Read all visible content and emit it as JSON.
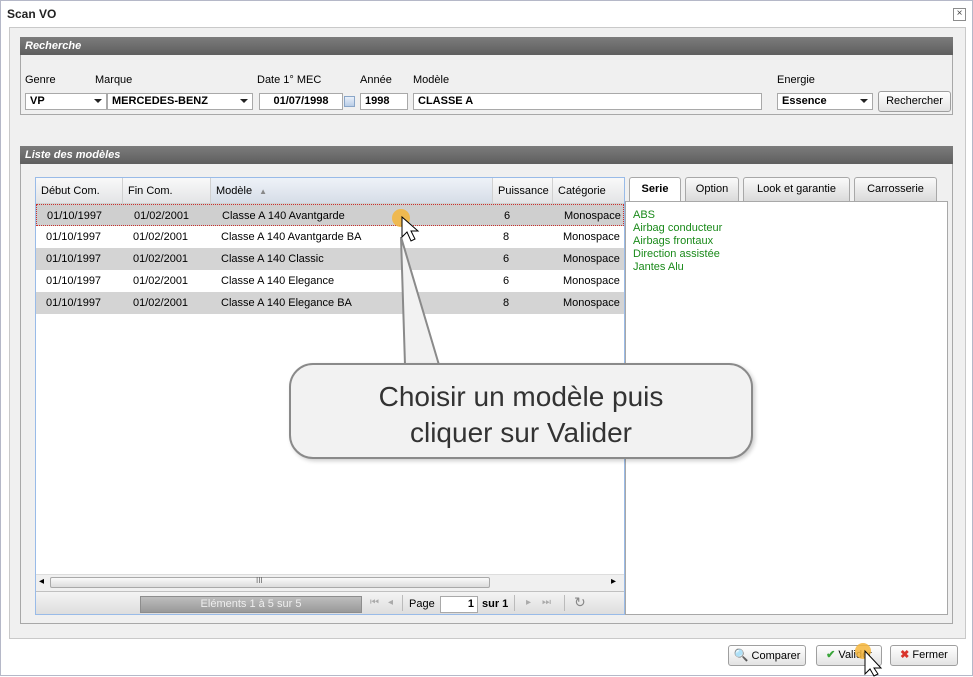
{
  "window": {
    "title": "Scan VO",
    "close_glyph": "×"
  },
  "search_panel": {
    "header": "Recherche",
    "labels": {
      "genre": "Genre",
      "marque": "Marque",
      "date_mec": "Date 1° MEC",
      "annee": "Année",
      "modele": "Modèle",
      "energie": "Energie"
    },
    "values": {
      "genre": "VP",
      "marque": "MERCEDES-BENZ",
      "date_mec": "01/07/1998",
      "annee": "1998",
      "modele": "CLASSE A",
      "energie": "Essence"
    },
    "search_button": "Rechercher"
  },
  "models_panel": {
    "header": "Liste des modèles",
    "columns": [
      "Début Com.",
      "Fin Com.",
      "Modèle",
      "Puissance",
      "Catégorie"
    ],
    "sort_indicator": "▲",
    "rows": [
      [
        "01/10/1997",
        "01/02/2001",
        "Classe A 140 Avantgarde",
        "6",
        "Monospace"
      ],
      [
        "01/10/1997",
        "01/02/2001",
        "Classe A 140 Avantgarde BA",
        "8",
        "Monospace"
      ],
      [
        "01/10/1997",
        "01/02/2001",
        "Classe A 140 Classic",
        "6",
        "Monospace"
      ],
      [
        "01/10/1997",
        "01/02/2001",
        "Classe A 140 Elegance",
        "6",
        "Monospace"
      ],
      [
        "01/10/1997",
        "01/02/2001",
        "Classe A 140 Elegance BA",
        "8",
        "Monospace"
      ]
    ],
    "scroll": {
      "left": "◂",
      "grip": "III",
      "right": "▸"
    },
    "pager": {
      "display": "Eléments 1 à 5 sur 5",
      "first": "⏮",
      "prev": "◂",
      "next": "▸",
      "last": "⏭",
      "refresh": "↻",
      "page_label": "Page",
      "page_value": "1",
      "of_label": "sur 1"
    }
  },
  "tabs": {
    "items": [
      "Serie",
      "Option",
      "Look et garantie",
      "Carrosserie"
    ],
    "active": "Serie",
    "features": [
      "ABS",
      "Airbag conducteur",
      "Airbags frontaux",
      "Direction assistée",
      "Jantes Alu"
    ]
  },
  "callout": {
    "text": "Choisir un modèle puis\ncliquer sur Valider"
  },
  "footer": {
    "compare": "Comparer",
    "validate": "Valider",
    "close": "Fermer"
  },
  "colors": {
    "panel_header": "#6b6b6b",
    "feature_text": "#1a8a1a",
    "check_green": "#3aa53a",
    "close_red": "#d9342b",
    "row_alt": "#d4d4d4"
  }
}
